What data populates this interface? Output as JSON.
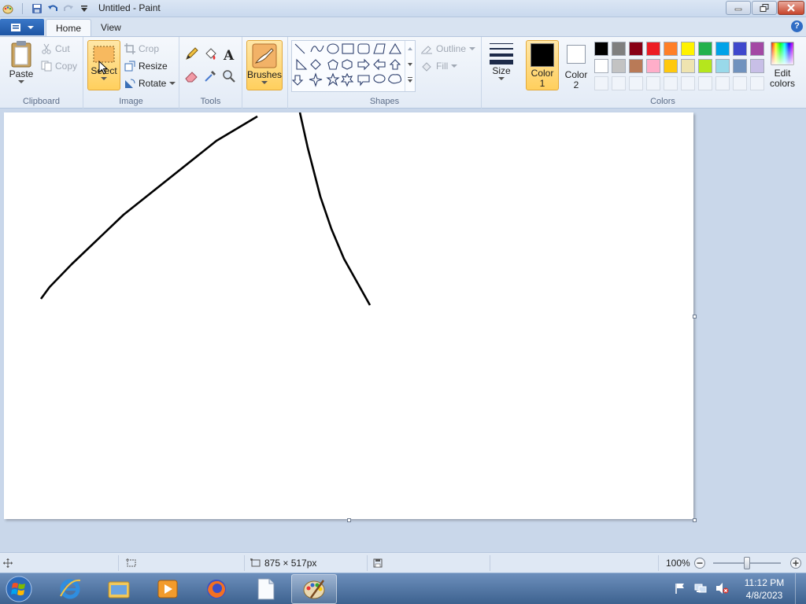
{
  "window": {
    "title": "Untitled - Paint"
  },
  "tabs": [
    {
      "label": "Home"
    },
    {
      "label": "View"
    }
  ],
  "ribbon": {
    "clipboard": {
      "label": "Clipboard",
      "paste": "Paste",
      "cut": "Cut",
      "copy": "Copy"
    },
    "image": {
      "label": "Image",
      "select": "Select",
      "crop": "Crop",
      "resize": "Resize",
      "rotate": "Rotate"
    },
    "tools": {
      "label": "Tools"
    },
    "brushes": {
      "label": "Brushes"
    },
    "shapes": {
      "label": "Shapes",
      "outline": "Outline",
      "fill": "Fill"
    },
    "size": {
      "label": "Size"
    },
    "colors": {
      "label": "Colors",
      "color1_line1": "Color",
      "color1_line2": "1",
      "color2_line1": "Color",
      "color2_line2": "2",
      "edit_line1": "Edit",
      "edit_line2": "colors",
      "color1_value": "#000000",
      "color2_value": "#ffffff",
      "palette_row1": [
        "#000000",
        "#7f7f7f",
        "#880015",
        "#ed1c24",
        "#ff7f27",
        "#fff200",
        "#22b14c",
        "#00a2e8",
        "#3f48cc",
        "#a349a4"
      ],
      "palette_row2": [
        "#ffffff",
        "#c3c3c3",
        "#b97a57",
        "#ffaec9",
        "#ffc90e",
        "#efe4b0",
        "#b5e61d",
        "#99d9ea",
        "#7092be",
        "#c8bfe7"
      ]
    }
  },
  "statusbar": {
    "dimensions": "875 × 517px",
    "zoom": "100%",
    "zoom_level": 0.5
  },
  "taskbar": {
    "time": "11:12 PM",
    "date": "4/8/2023"
  }
}
